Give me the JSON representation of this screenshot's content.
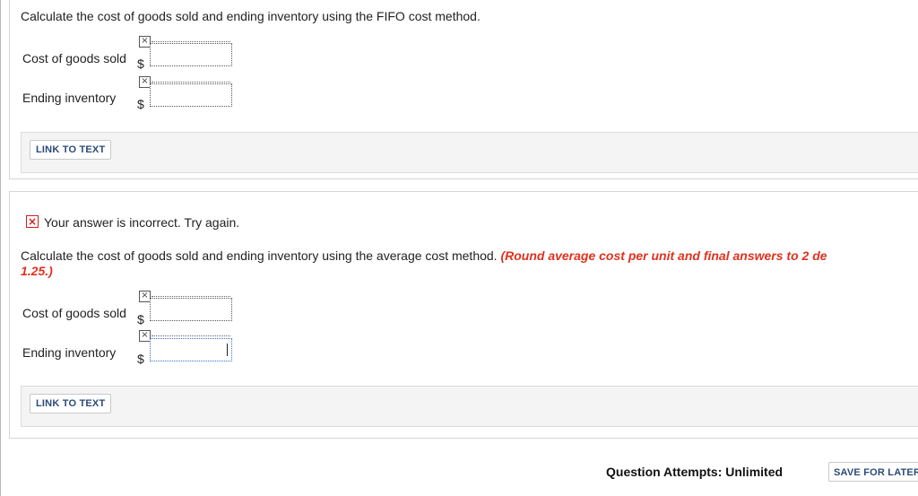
{
  "fifo": {
    "question": "Calculate the cost of goods sold and ending inventory using the FIFO cost method.",
    "cogs_label": "Cost of goods sold",
    "ending_label": "Ending inventory",
    "currency": "$",
    "cogs_value": "",
    "ending_value": "",
    "link_label": "LINK TO TEXT"
  },
  "average": {
    "feedback": "Your answer is incorrect.  Try again.",
    "question": "Calculate the cost of goods sold and ending inventory using the average cost method.",
    "hint": "(Round average cost per unit and final answers to 2 de",
    "hint_line2": "1.25.)",
    "cogs_label": "Cost of goods sold",
    "ending_label": "Ending inventory",
    "currency": "$",
    "cogs_value": "",
    "ending_value": "",
    "link_label": "LINK TO TEXT"
  },
  "footer": {
    "attempts": "Question Attempts: Unlimited",
    "save_label": "SAVE FOR LATER"
  },
  "icons": {
    "broken_image": "×",
    "incorrect": "×"
  },
  "colors": {
    "hint": "#e0321e",
    "incorrect": "#d21e1e",
    "link": "#2b4a7a"
  }
}
